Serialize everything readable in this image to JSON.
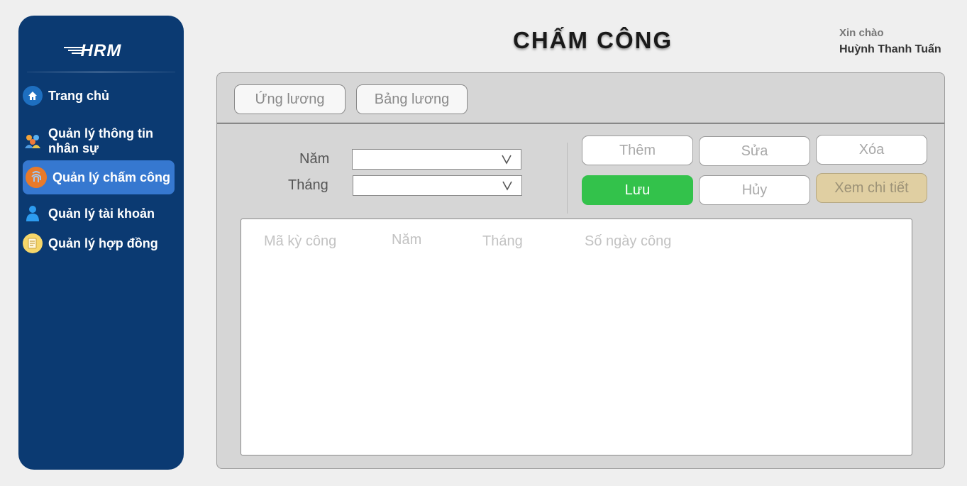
{
  "sidebar": {
    "logo": "HRM",
    "items": [
      {
        "label": "Trang chủ",
        "icon": "home-icon"
      },
      {
        "label": "Quản lý thông tin nhân sự",
        "icon": "people-icon"
      },
      {
        "label": "Quản lý chấm công",
        "icon": "fingerprint-icon",
        "active": true
      },
      {
        "label": "Quản lý tài khoản",
        "icon": "user-icon"
      },
      {
        "label": "Quản lý hợp đồng",
        "icon": "contract-icon"
      }
    ]
  },
  "header": {
    "title": "CHẤM CÔNG",
    "greeting": "Xin chào",
    "user_name": "Huỳnh Thanh Tuấn"
  },
  "tabs": [
    "Ứng lương",
    "Bảng lương"
  ],
  "filters": {
    "year_label": "Năm",
    "year_value": "",
    "month_label": "Tháng",
    "month_value": ""
  },
  "actions": {
    "add": "Thêm",
    "edit": "Sửa",
    "delete": "Xóa",
    "save": "Lưu",
    "cancel": "Hủy",
    "detail": "Xem chi tiết"
  },
  "table": {
    "columns": [
      "Mã kỳ công",
      "Năm",
      "Tháng",
      "Số ngày công"
    ],
    "rows": []
  },
  "colors": {
    "sidebar_bg": "#0b3a72",
    "active_item": "#3678d0",
    "save_button": "#33c24b",
    "detail_button": "#e0cfa2"
  }
}
